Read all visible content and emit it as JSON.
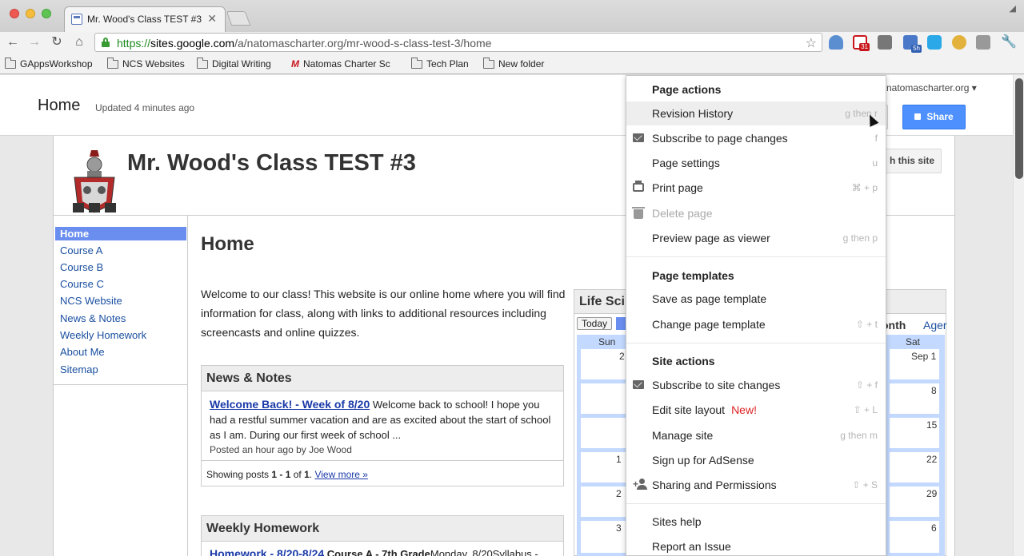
{
  "browser": {
    "tab_title": "Mr. Wood's Class TEST #3",
    "url_scheme": "https://",
    "url_host": "sites.google.com",
    "url_path": "/a/natomascharter.org/mr-wood-s-class-test-3/home",
    "ext_badges": {
      "gmail": "31",
      "calendar": "5h"
    },
    "bookmarks": [
      "GAppsWorkshop",
      "NCS Websites",
      "Digital Writing",
      "Natomas Charter Sc",
      "Tech Plan",
      "New folder"
    ]
  },
  "header": {
    "page_name": "Home",
    "updated": "Updated 4 minutes ago",
    "account": "natomascharter.org",
    "share_label": "Share"
  },
  "site": {
    "title": "Mr. Wood's Class TEST #3",
    "search_label": "h this site",
    "nav": [
      "Home",
      "Course A",
      "Course B",
      "Course C",
      "NCS Website",
      "News & Notes",
      "Weekly Homework",
      "About Me",
      "Sitemap"
    ],
    "main_title": "Home",
    "welcome": "Welcome to our class!  This website is our online home where you will find information for class, along with links to additional resources including screencasts and online quizzes.",
    "news": {
      "heading": "News & Notes",
      "post_title": "Welcome Back! - Week of 8/20",
      "post_body": " Welcome back to school!  I hope you had a restful summer vacation and are as excited about the start of school as I am.  During our first week of school ...",
      "post_meta": "Posted an hour ago by Joe Wood",
      "showing_prefix": "Showing posts ",
      "showing_range": "1 - 1",
      "showing_mid": " of ",
      "showing_total": "1",
      "showing_suffix": ". ",
      "view_more": "View more »"
    },
    "homework": {
      "heading": "Weekly Homework",
      "post_title": "Homework - 8/20-8/24",
      "post_course": " Course A - 7th Grade",
      "post_body": "Monday, 8/20Syllabus -"
    },
    "calendar": {
      "heading": "Life Sci",
      "today": "Today",
      "month": "onth",
      "agenda": "Ager",
      "dow_sun": "Sun",
      "dow_sat": "Sat",
      "sun_nums": [
        "2",
        "",
        "",
        "1",
        "2",
        "3"
      ],
      "sat_nums": [
        "Sep 1",
        "8",
        "15",
        "22",
        "29",
        "6"
      ]
    }
  },
  "menu": {
    "page_actions_header": "Page actions",
    "page_templates_header": "Page templates",
    "site_actions_header": "Site actions",
    "items": {
      "revision_history": {
        "label": "Revision History",
        "shortcut": "g then r"
      },
      "subscribe_page": {
        "label": "Subscribe to page changes",
        "shortcut": "f"
      },
      "page_settings": {
        "label": "Page settings",
        "shortcut": "u"
      },
      "print_page": {
        "label": "Print page",
        "shortcut": "⌘ + p"
      },
      "delete_page": {
        "label": "Delete page",
        "shortcut": ""
      },
      "preview_page": {
        "label": "Preview page as viewer",
        "shortcut": "g then p"
      },
      "save_template": {
        "label": "Save as page template",
        "shortcut": ""
      },
      "change_template": {
        "label": "Change page template",
        "shortcut": "⇧ + t"
      },
      "subscribe_site": {
        "label": "Subscribe to site changes",
        "shortcut": "⇧ + f"
      },
      "edit_layout": {
        "label": "Edit site layout",
        "new": "New!",
        "shortcut": "⇧ + L"
      },
      "manage_site": {
        "label": "Manage site",
        "shortcut": "g then m"
      },
      "adsense": {
        "label": "Sign up for AdSense",
        "shortcut": ""
      },
      "sharing": {
        "label": "Sharing and Permissions",
        "shortcut": "⇧ + S"
      },
      "help": {
        "label": "Sites help",
        "shortcut": ""
      },
      "report": {
        "label": "Report an Issue",
        "shortcut": ""
      }
    }
  }
}
